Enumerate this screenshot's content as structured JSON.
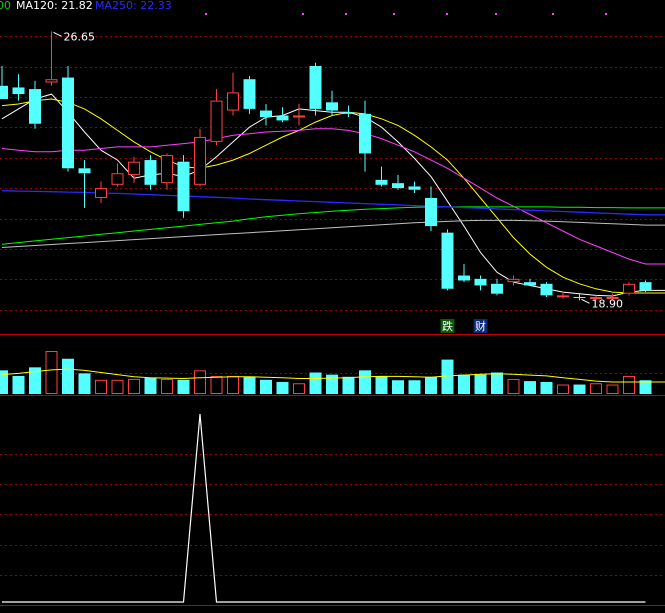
{
  "legend": {
    "ma_prev_fragment": "00",
    "ma120": "MA120: 21.82",
    "ma250": "MA250: 22.33"
  },
  "colors": {
    "up": "#ff4040",
    "down": "#54ffff",
    "ma5": "#ffffff",
    "ma10": "#ffff00",
    "ma20": "#ff40ff",
    "ma60": "#00ff00",
    "ma120": "#2a2aff",
    "ma250": "#c0c0c0",
    "grid": "#990000",
    "separator": "#c00000",
    "legend_green": "#00cc00",
    "legend_white": "#ffffff",
    "legend_blue": "#2a2aff",
    "signal": "#ffffff"
  },
  "chart_data": [
    {
      "type": "candlestick",
      "ylim": [
        17.6,
        27.6
      ],
      "annotations": {
        "high_label": "26.65",
        "low_label": "18.90"
      },
      "badges": [
        {
          "text": "跌",
          "index": 27
        },
        {
          "text": "财",
          "index": 29
        }
      ],
      "candles": [
        {
          "o": 25.0,
          "h": 25.6,
          "l": 24.6,
          "c": 24.6
        },
        {
          "o": 24.95,
          "h": 25.35,
          "l": 24.55,
          "c": 24.75
        },
        {
          "o": 24.9,
          "h": 25.15,
          "l": 23.7,
          "c": 23.85
        },
        {
          "o": 25.1,
          "h": 26.65,
          "l": 25.0,
          "c": 25.2
        },
        {
          "o": 25.25,
          "h": 25.6,
          "l": 22.4,
          "c": 22.5
        },
        {
          "o": 22.5,
          "h": 22.75,
          "l": 21.3,
          "c": 22.35
        },
        {
          "o": 21.6,
          "h": 22.1,
          "l": 21.45,
          "c": 21.9
        },
        {
          "o": 22.0,
          "h": 22.65,
          "l": 21.95,
          "c": 22.35
        },
        {
          "o": 22.3,
          "h": 22.85,
          "l": 22.05,
          "c": 22.7
        },
        {
          "o": 22.75,
          "h": 22.9,
          "l": 21.85,
          "c": 22.0
        },
        {
          "o": 22.05,
          "h": 22.95,
          "l": 21.85,
          "c": 22.9
        },
        {
          "o": 22.7,
          "h": 22.9,
          "l": 21.0,
          "c": 21.2
        },
        {
          "o": 22.0,
          "h": 23.7,
          "l": 21.95,
          "c": 23.45
        },
        {
          "o": 23.3,
          "h": 24.9,
          "l": 23.2,
          "c": 24.55
        },
        {
          "o": 24.25,
          "h": 25.4,
          "l": 24.1,
          "c": 24.8
        },
        {
          "o": 25.2,
          "h": 25.3,
          "l": 24.15,
          "c": 24.3
        },
        {
          "o": 24.25,
          "h": 24.45,
          "l": 23.8,
          "c": 24.05
        },
        {
          "o": 24.1,
          "h": 24.35,
          "l": 23.9,
          "c": 23.95
        },
        {
          "o": 24.05,
          "h": 24.45,
          "l": 23.8,
          "c": 24.1
        },
        {
          "o": 25.6,
          "h": 25.7,
          "l": 24.1,
          "c": 24.3
        },
        {
          "o": 24.5,
          "h": 24.85,
          "l": 24.1,
          "c": 24.25
        },
        {
          "o": 24.2,
          "h": 24.4,
          "l": 24.05,
          "c": 24.15
        },
        {
          "o": 24.15,
          "h": 24.55,
          "l": 22.4,
          "c": 22.95
        },
        {
          "o": 22.15,
          "h": 22.55,
          "l": 21.95,
          "c": 22.0
        },
        {
          "o": 22.05,
          "h": 22.3,
          "l": 21.85,
          "c": 21.9
        },
        {
          "o": 21.95,
          "h": 22.1,
          "l": 21.75,
          "c": 21.85
        },
        {
          "o": 21.6,
          "h": 21.95,
          "l": 20.6,
          "c": 20.75
        },
        {
          "o": 20.55,
          "h": 20.65,
          "l": 18.8,
          "c": 18.85
        },
        {
          "o": 19.25,
          "h": 19.6,
          "l": 19.05,
          "c": 19.1
        },
        {
          "o": 19.15,
          "h": 19.25,
          "l": 18.8,
          "c": 18.95
        },
        {
          "o": 19.0,
          "h": 19.15,
          "l": 18.65,
          "c": 18.7
        },
        {
          "o": 19.05,
          "h": 19.25,
          "l": 18.95,
          "c": 19.15
        },
        {
          "o": 19.05,
          "h": 19.15,
          "l": 18.95,
          "c": 18.95
        },
        {
          "o": 19.0,
          "h": 19.05,
          "l": 18.6,
          "c": 18.65
        },
        {
          "o": 18.65,
          "h": 18.75,
          "l": 18.55,
          "c": 18.65
        },
        {
          "o": 18.6,
          "h": 18.7,
          "l": 18.5,
          "c": 18.58
        },
        {
          "o": 18.55,
          "h": 18.65,
          "l": 18.5,
          "c": 18.6
        },
        {
          "o": 18.6,
          "h": 18.7,
          "l": 18.5,
          "c": 18.6
        },
        {
          "o": 18.7,
          "h": 19.05,
          "l": 18.65,
          "c": 19.0
        },
        {
          "o": 19.05,
          "h": 19.1,
          "l": 18.75,
          "c": 18.8
        }
      ],
      "ma": [
        {
          "key": "ma5",
          "values": [
            24.0,
            24.3,
            24.6,
            24.75,
            24.2,
            23.6,
            23.05,
            22.75,
            22.2,
            22.3,
            22.35,
            22.25,
            22.45,
            22.85,
            23.3,
            23.75,
            24.05,
            24.1,
            24.3,
            24.25,
            24.2,
            24.2,
            24.05,
            23.75,
            23.3,
            22.8,
            22.25,
            21.5,
            20.75,
            19.95,
            19.35,
            19.05,
            18.95,
            18.85,
            18.75,
            18.7,
            18.65,
            18.63,
            18.75,
            18.8
          ]
        },
        {
          "key": "ma10",
          "values": [
            24.4,
            24.45,
            24.55,
            24.6,
            24.5,
            24.3,
            24.0,
            23.65,
            23.3,
            23.0,
            22.75,
            22.55,
            22.5,
            22.6,
            22.75,
            22.95,
            23.2,
            23.45,
            23.65,
            23.9,
            24.1,
            24.2,
            24.15,
            24.0,
            23.8,
            23.5,
            23.15,
            22.75,
            22.2,
            21.6,
            21.0,
            20.4,
            19.9,
            19.5,
            19.2,
            19.0,
            18.85,
            18.75,
            18.72,
            18.72
          ]
        },
        {
          "key": "ma20",
          "values": [
            23.1,
            23.05,
            23.0,
            23.0,
            23.05,
            23.05,
            23.1,
            23.15,
            23.15,
            23.15,
            23.2,
            23.25,
            23.3,
            23.4,
            23.5,
            23.55,
            23.6,
            23.62,
            23.65,
            23.7,
            23.7,
            23.65,
            23.55,
            23.4,
            23.2,
            23.0,
            22.75,
            22.5,
            22.2,
            21.9,
            21.6,
            21.35,
            21.1,
            20.85,
            20.6,
            20.35,
            20.15,
            19.95,
            19.75,
            19.6
          ]
        },
        {
          "key": "ma60",
          "values": [
            20.2,
            20.25,
            20.3,
            20.35,
            20.4,
            20.45,
            20.5,
            20.55,
            20.6,
            20.65,
            20.7,
            20.75,
            20.8,
            20.85,
            20.9,
            20.97,
            21.03,
            21.08,
            21.12,
            21.16,
            21.2,
            21.23,
            21.26,
            21.28,
            21.3,
            21.32,
            21.33,
            21.33,
            21.33,
            21.33,
            21.33,
            21.33,
            21.33,
            21.33,
            21.32,
            21.32,
            21.31,
            21.31,
            21.3,
            21.3
          ]
        },
        {
          "key": "ma120",
          "values": [
            21.82,
            21.81,
            21.8,
            21.79,
            21.78,
            21.77,
            21.75,
            21.74,
            21.72,
            21.7,
            21.68,
            21.66,
            21.64,
            21.62,
            21.6,
            21.57,
            21.55,
            21.53,
            21.51,
            21.49,
            21.47,
            21.45,
            21.43,
            21.41,
            21.39,
            21.37,
            21.35,
            21.33,
            21.31,
            21.29,
            21.27,
            21.25,
            21.23,
            21.21,
            21.19,
            21.17,
            21.15,
            21.13,
            21.11,
            21.09
          ]
        },
        {
          "key": "ma250",
          "values": [
            20.1,
            20.13,
            20.16,
            20.19,
            20.22,
            20.25,
            20.28,
            20.31,
            20.34,
            20.37,
            20.4,
            20.43,
            20.46,
            20.49,
            20.52,
            20.55,
            20.58,
            20.61,
            20.64,
            20.67,
            20.7,
            20.73,
            20.76,
            20.79,
            20.82,
            20.85,
            20.87,
            20.89,
            20.91,
            20.92,
            20.92,
            20.92,
            20.91,
            20.9,
            20.88,
            20.86,
            20.84,
            20.82,
            20.8,
            20.78
          ]
        }
      ]
    },
    {
      "type": "bar",
      "role": "volume",
      "ylim": [
        0,
        1
      ],
      "values": [
        0.55,
        0.42,
        0.62,
        1.0,
        0.82,
        0.48,
        0.33,
        0.33,
        0.35,
        0.38,
        0.35,
        0.33,
        0.55,
        0.42,
        0.42,
        0.4,
        0.33,
        0.28,
        0.25,
        0.5,
        0.45,
        0.4,
        0.55,
        0.42,
        0.32,
        0.32,
        0.4,
        0.8,
        0.45,
        0.45,
        0.5,
        0.35,
        0.3,
        0.28,
        0.22,
        0.22,
        0.25,
        0.22,
        0.42,
        0.32
      ],
      "ma_line": [
        0.45,
        0.48,
        0.52,
        0.56,
        0.58,
        0.55,
        0.5,
        0.45,
        0.4,
        0.38,
        0.37,
        0.36,
        0.38,
        0.39,
        0.4,
        0.4,
        0.39,
        0.38,
        0.36,
        0.36,
        0.37,
        0.38,
        0.4,
        0.41,
        0.41,
        0.4,
        0.39,
        0.42,
        0.44,
        0.46,
        0.47,
        0.46,
        0.44,
        0.42,
        0.38,
        0.34,
        0.3,
        0.28,
        0.28,
        0.28
      ]
    },
    {
      "type": "line",
      "role": "signal",
      "ylim": [
        0,
        1
      ],
      "values": [
        0,
        0,
        0,
        0,
        0,
        0,
        0,
        0,
        0,
        0,
        0,
        0,
        1,
        0,
        0,
        0,
        0,
        0,
        0,
        0,
        0,
        0,
        0,
        0,
        0,
        0,
        0,
        0,
        0,
        0,
        0,
        0,
        0,
        0,
        0,
        0,
        0,
        0,
        0,
        0
      ]
    }
  ]
}
